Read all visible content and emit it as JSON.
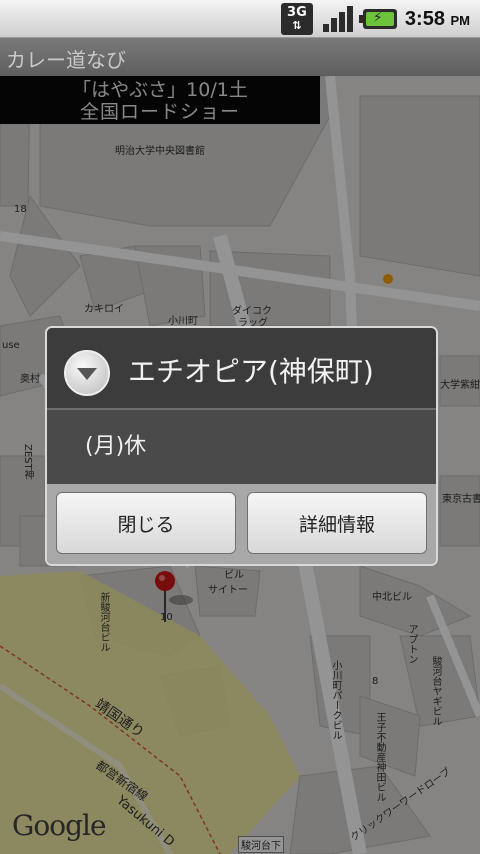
{
  "status_bar": {
    "network": "3G",
    "time": "3:58",
    "ampm": "PM"
  },
  "app": {
    "title": "カレー道なび"
  },
  "banner": {
    "line1": "「はやぶさ」10/1土",
    "line2": "全国ロードショー"
  },
  "map": {
    "labels": {
      "library": "明治大学中央図書館",
      "n18": "18",
      "kakiroi": "カキロイ",
      "ogawamachi": "小川町",
      "daikoku": "ダイコク",
      "drug": "ラッグ",
      "daigaku": "大学紫紺館",
      "tokyo_komu": "東京古書会",
      "use": "use",
      "okumura": "奥村",
      "zest": "ZEST神",
      "shin_sur": "新駿河台ビル",
      "n10": "10",
      "saitoh": "サイトー",
      "biru": "ビル",
      "chuoku": "中北ビル",
      "apton": "アプトン",
      "surugadai_yakushi": "駿河台ヤギビル",
      "n8": "8",
      "ogawacho_park": "小川町パークビル",
      "oji": "王子不動産神田ビル",
      "yasukuni_dori": "靖国通り",
      "toei": "都営新宿線",
      "yasukuni": "Yasukuni D",
      "surugadai_shita": "駿河台下",
      "click_tower": "クリックワーワードローブ",
      "google": "Google"
    }
  },
  "dialog": {
    "title": "エチオピア(神保町)",
    "message": "(月)休",
    "buttons": {
      "close": "閉じる",
      "detail": "詳細情報"
    }
  },
  "colors": {
    "map_bg": "#e6e4e0",
    "block": "#d6d3cf",
    "road": "#ffffff",
    "yasukuni_road": "#f2ec9a",
    "marker": "#d01818",
    "battery": "#6cc43b"
  }
}
